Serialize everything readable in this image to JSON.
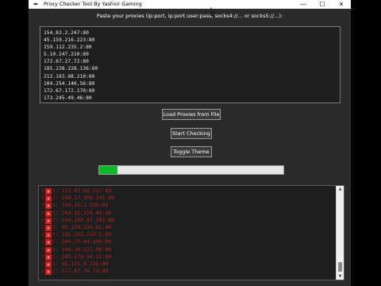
{
  "window": {
    "title": "Proxy Checker Tool By Yashvir Gaming",
    "minimize_glyph": "—",
    "maximize_glyph": "☐",
    "close_glyph": "✕"
  },
  "prompt": "Paste your proxies (ip:port, ip:port:user:pass, socks4://... or socks5://...):",
  "proxies": [
    "154.83.2.247:80",
    "45.159.216.223:80",
    "159.112.235.2:80",
    "5.10.247.210:80",
    "172.67.27.72:80",
    "185.238.228.136:80",
    "212.183.88.210:80",
    "104.254.140.56:80",
    "172.67.172.170:80",
    "173.245.49.46:80"
  ],
  "buttons": {
    "load": "Load Proxies from File",
    "start": "Start Checking",
    "toggle": "Toggle Theme"
  },
  "progress": {
    "fraction": 0.1,
    "color": "#0bba2b"
  },
  "results": [
    ": 172.67.68.227:80",
    ": 104.17.108.241:80",
    ": 104.16.1.199:80",
    ": 104.25.158.43:80",
    ": 104.160.87.201:80",
    ": 45.159.216.61:80",
    ": 185.162.229.5:80",
    ": 104.27.44.190:80",
    ": 104.28.222.90:80",
    ": 185.176.24.12:80",
    ": 45.131.4.136:80",
    ": 172.67.70.79:80"
  ],
  "result_status_icon": "x-mark-icon",
  "colors": {
    "fail_text": "#b32424",
    "fail_icon": "#d11b1b"
  }
}
